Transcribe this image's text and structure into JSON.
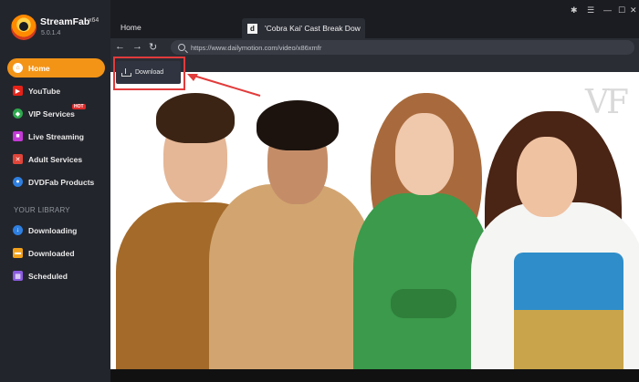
{
  "app": {
    "name": "StreamFab",
    "suffix": "x64",
    "version": "5.0.1.4"
  },
  "sidebar": {
    "items": [
      {
        "label": "Home",
        "icon": "home-icon",
        "color": "#f39417"
      },
      {
        "label": "YouTube",
        "icon": "youtube-icon",
        "color": "#e62117"
      },
      {
        "label": "VIP Services",
        "icon": "vip-icon",
        "color": "#2fa84f",
        "badge": "HOT"
      },
      {
        "label": "Live Streaming",
        "icon": "live-streaming-icon",
        "color": "#c43ad6"
      },
      {
        "label": "Adult Services",
        "icon": "adult-services-icon",
        "color": "#e0453a"
      },
      {
        "label": "DVDFab Products",
        "icon": "dvdfab-icon",
        "color": "#2e7fe0"
      }
    ],
    "library_label": "YOUR LIBRARY",
    "library": [
      {
        "label": "Downloading",
        "icon": "downloading-icon",
        "color": "#2e7fe0"
      },
      {
        "label": "Downloaded",
        "icon": "downloaded-icon",
        "color": "#f3a21b"
      },
      {
        "label": "Scheduled",
        "icon": "scheduled-icon",
        "color": "#8a5be0"
      }
    ]
  },
  "tabs": {
    "home": "Home",
    "video_tab": "'Cobra Kai' Cast Break Dow",
    "video_tab_favicon": "d"
  },
  "address": {
    "url": "https://www.dailymotion.com/video/x86xmfr"
  },
  "player": {
    "watermark": "VF"
  },
  "overlay": {
    "download_label": "Download",
    "accent": "#e23b3b"
  }
}
